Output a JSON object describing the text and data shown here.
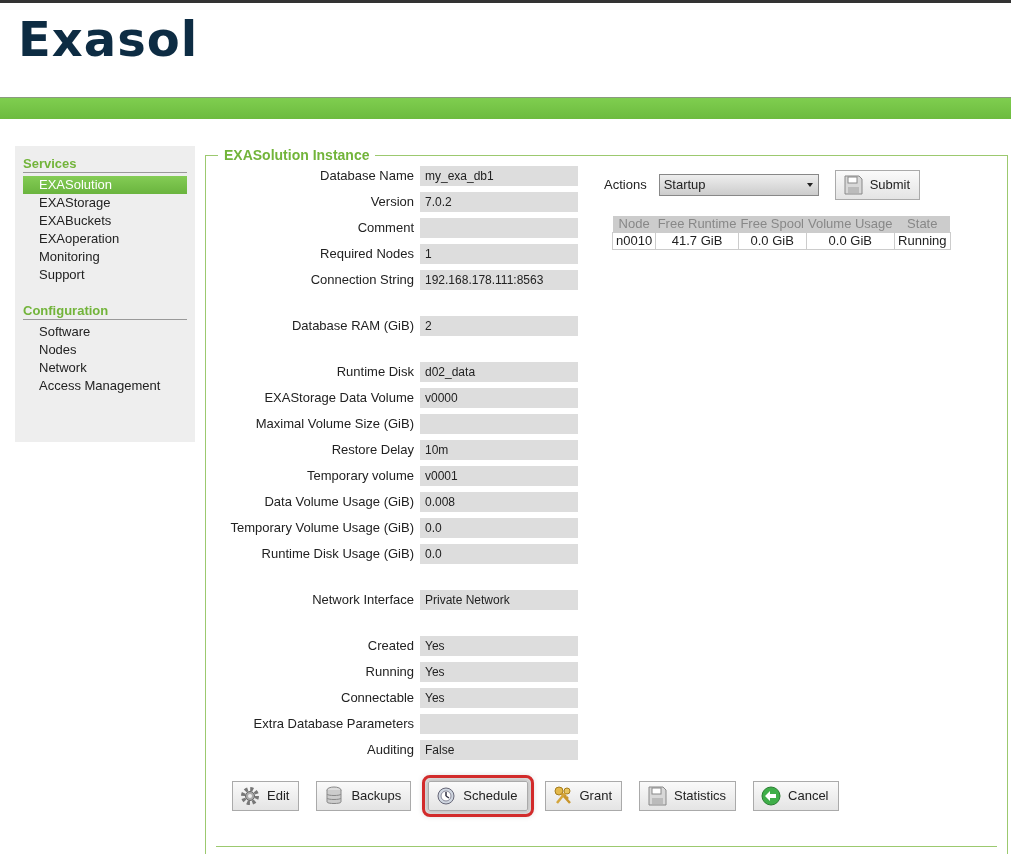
{
  "logo": "Exasol",
  "sidebar": [
    {
      "heading": "Services",
      "items": [
        {
          "label": "EXASolution",
          "selected": true
        },
        {
          "label": "EXAStorage",
          "selected": false
        },
        {
          "label": "EXABuckets",
          "selected": false
        },
        {
          "label": "EXAoperation",
          "selected": false
        },
        {
          "label": "Monitoring",
          "selected": false
        },
        {
          "label": "Support",
          "selected": false
        }
      ]
    },
    {
      "heading": "Configuration",
      "items": [
        {
          "label": "Software",
          "selected": false
        },
        {
          "label": "Nodes",
          "selected": false
        },
        {
          "label": "Network",
          "selected": false
        },
        {
          "label": "Access Management",
          "selected": false
        }
      ]
    }
  ],
  "instance": {
    "title": "EXASolution Instance",
    "field_groups": [
      [
        {
          "label": "Database Name",
          "value": "my_exa_db1"
        },
        {
          "label": "Version",
          "value": "7.0.2"
        },
        {
          "label": "Comment"
        },
        {
          "label": "Required Nodes",
          "value": "1"
        },
        {
          "label": "Connection String",
          "value": "192.168.178.111:8563"
        }
      ],
      [
        {
          "label": "Database RAM (GiB)",
          "value": "2"
        }
      ],
      [
        {
          "label": "Runtime Disk",
          "value": "d02_data"
        },
        {
          "label": "EXAStorage Data Volume",
          "value": "v0000"
        },
        {
          "label": "Maximal Volume Size (GiB)"
        },
        {
          "label": "Restore Delay",
          "value": "10m"
        },
        {
          "label": "Temporary volume",
          "value": "v0001"
        },
        {
          "label": "Data Volume Usage (GiB)",
          "value": "0.008"
        },
        {
          "label": "Temporary Volume Usage (GiB)",
          "value": "0.0"
        },
        {
          "label": "Runtime Disk Usage (GiB)",
          "value": "0.0"
        }
      ],
      [
        {
          "label": "Network Interface",
          "value": "Private Network"
        }
      ],
      [
        {
          "label": "Created",
          "value": "Yes"
        },
        {
          "label": "Running",
          "value": "Yes"
        },
        {
          "label": "Connectable",
          "value": "Yes"
        },
        {
          "label": "Extra Database Parameters"
        },
        {
          "label": "Auditing",
          "value": "False"
        }
      ]
    ],
    "actions": {
      "label": "Actions",
      "value": "Startup",
      "submit": "Submit"
    },
    "nodes_table": {
      "columns": [
        "Node",
        "Free Runtime",
        "Free Spool",
        "Volume Usage",
        "State"
      ],
      "rows": [
        [
          "n0010",
          "41.7 GiB",
          "0.0 GiB",
          "0.0 GiB",
          "Running"
        ]
      ]
    },
    "buttons": [
      {
        "label": "Edit",
        "kind": "gear",
        "highlighted": false
      },
      {
        "label": "Backups",
        "kind": "database",
        "highlighted": false
      },
      {
        "label": "Schedule",
        "kind": "clock",
        "highlighted": true
      },
      {
        "label": "Grant",
        "kind": "keys",
        "highlighted": false
      },
      {
        "label": "Statistics",
        "kind": "floppy",
        "highlighted": false
      },
      {
        "label": "Cancel",
        "kind": "back",
        "highlighted": false
      }
    ]
  }
}
